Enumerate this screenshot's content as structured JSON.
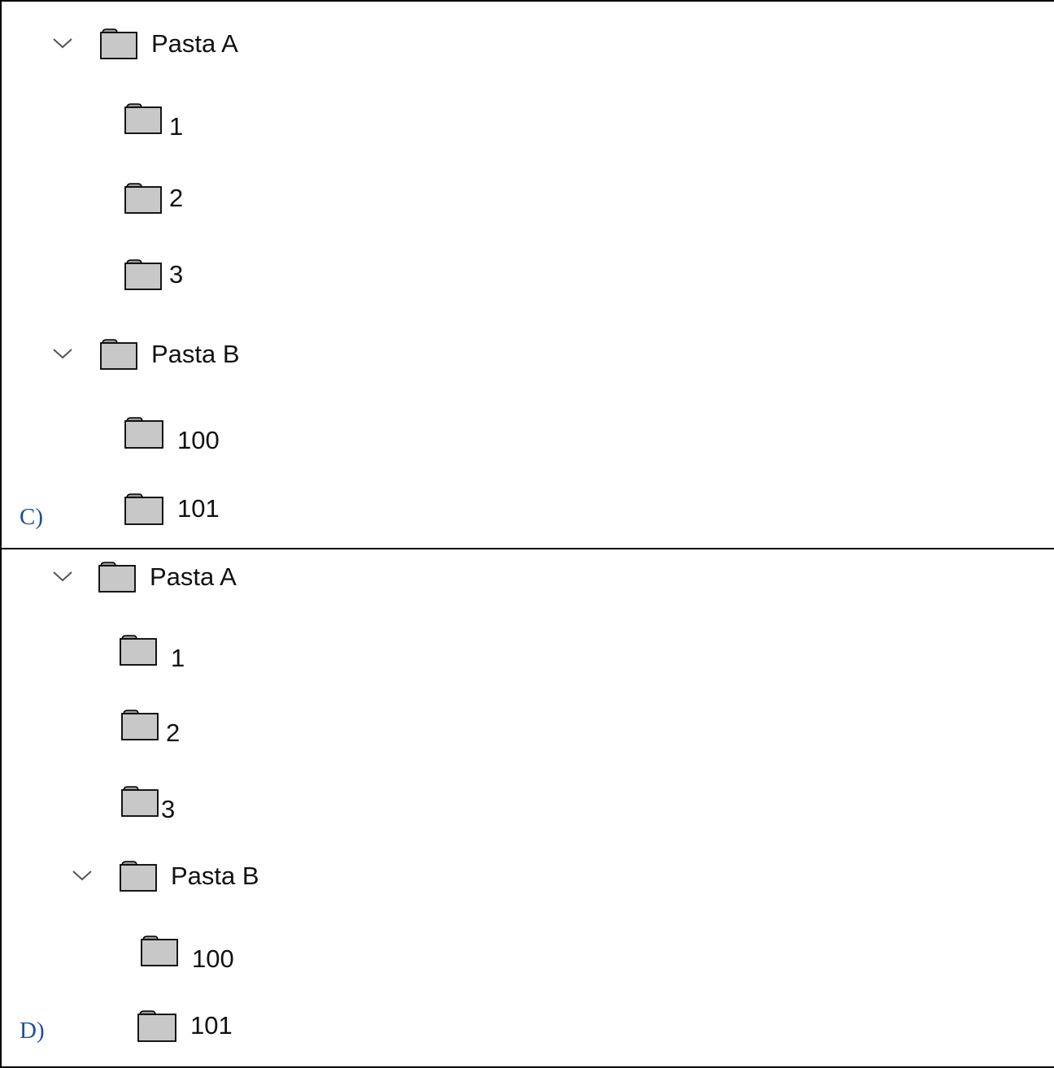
{
  "panels": [
    {
      "letter": "C)",
      "tree": {
        "folder_a": {
          "label": "Pasta A",
          "expanded": true,
          "children": [
            "1",
            "2",
            "3"
          ]
        },
        "folder_b": {
          "label": "Pasta B",
          "expanded": true,
          "children": [
            "100",
            "101"
          ]
        }
      }
    },
    {
      "letter": "D)",
      "tree": {
        "folder_a": {
          "label": "Pasta A",
          "expanded": true,
          "children": [
            "1",
            "2",
            "3"
          ]
        },
        "folder_b": {
          "label": "Pasta B",
          "expanded": true,
          "children": [
            "100",
            "101"
          ]
        }
      }
    }
  ],
  "icons": {
    "expand": "chevron-down-icon",
    "folder": "folder-icon"
  },
  "colors": {
    "folder_fill": "#c8c8c8",
    "folder_tab": "#9a9a9a",
    "letter": "#1f4e9a"
  }
}
